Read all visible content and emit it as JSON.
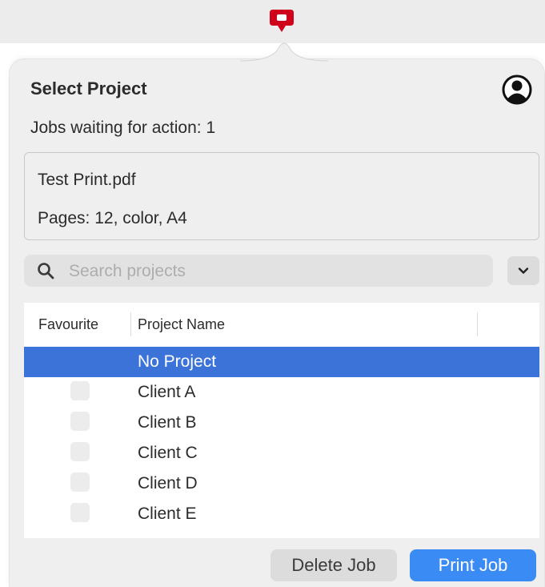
{
  "header": {
    "title": "Select Project",
    "jobs_waiting": "Jobs waiting for action: 1"
  },
  "job": {
    "file_name": "Test Print.pdf",
    "details": "Pages: 12, color, A4"
  },
  "search": {
    "placeholder": "Search projects",
    "value": ""
  },
  "table": {
    "columns": [
      "Favourite",
      "Project Name"
    ],
    "rows": [
      {
        "name": "No Project",
        "selected": true,
        "favourite_box": false
      },
      {
        "name": "Client A",
        "selected": false,
        "favourite_box": true
      },
      {
        "name": "Client B",
        "selected": false,
        "favourite_box": true
      },
      {
        "name": "Client C",
        "selected": false,
        "favourite_box": true
      },
      {
        "name": "Client D",
        "selected": false,
        "favourite_box": true
      },
      {
        "name": "Client E",
        "selected": false,
        "favourite_box": true
      }
    ]
  },
  "footer": {
    "delete_label": "Delete Job",
    "print_label": "Print Job"
  },
  "icons": {
    "app_logo": "q-logo-icon",
    "account": "account-circle-icon",
    "search": "search-icon",
    "dropdown": "chevron-down-icon"
  },
  "colors": {
    "brand": "#d0021b",
    "selection": "#3b73d9",
    "primary_button": "#3b8bf5"
  }
}
